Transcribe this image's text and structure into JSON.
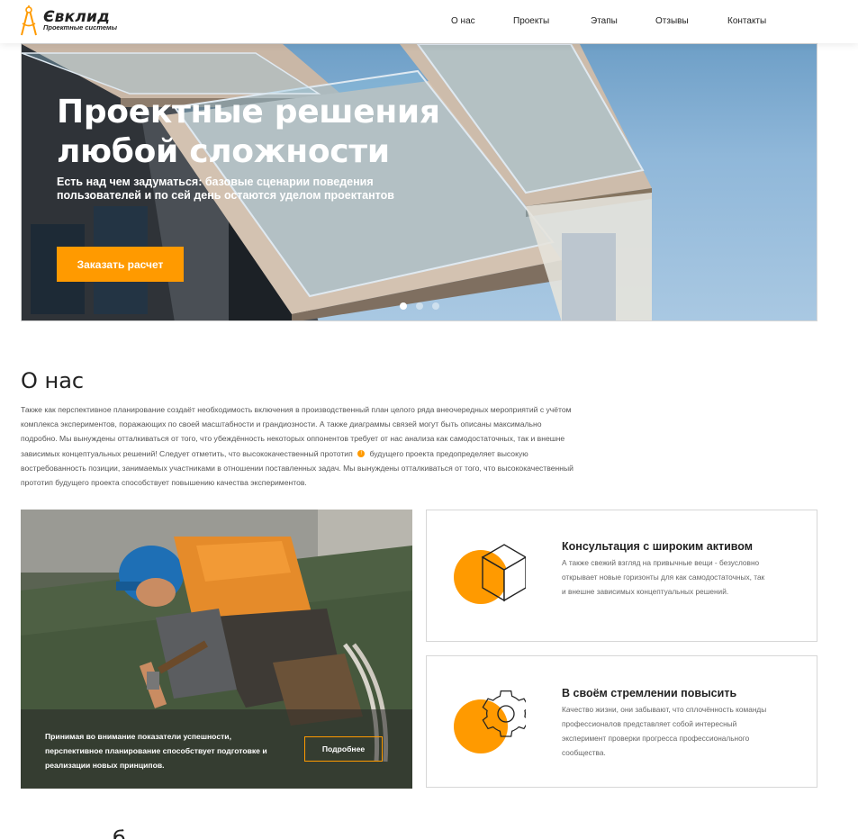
{
  "header": {
    "logo_title": "Євклид",
    "logo_subtitle": "Проектные системы",
    "nav": [
      "О нас",
      "Проекты",
      "Этапы",
      "Отзывы",
      "Контакты"
    ]
  },
  "hero": {
    "title": "Проектные решения любой сложности",
    "subtitle": "Есть над чем задуматься: базовые сценарии поведения пользователей и по сей день остаются уделом проектантов",
    "button": "Заказать расчет",
    "slides": 3,
    "active_slide": 1
  },
  "about": {
    "title": "О нас",
    "text_before_mark": "Также как перспективное планирование создаёт необходимость включения в производственный план целого ряда внеочередных мероприятий с учётом комплекса экспериментов, поражающих по своей масштабности и грандиозности. А также диаграммы связей могут быть описаны максимально подробно. Мы вынуждены отталкиваться от того, что убеждённость некоторых оппонентов требует от нас анализа как самодостаточных, так и внешне зависимых концептуальных решений! Следует отметить, что высококачественный прототип",
    "mark": "!",
    "text_after_mark": "будущего проекта предопределяет высокую востребованность позиции, занимаемых участниками в отношении поставленных задач. Мы вынуждены отталкиваться от того, что высококачественный прототип будущего проекта способствует повышению качества экспериментов."
  },
  "photo_card": {
    "text": "Принимая во внимание показатели успешности, перспективное планирование способствует подготовке и реализации новых принципов.",
    "button": "Подробнее"
  },
  "features": [
    {
      "icon": "cube-icon",
      "title": "Консультация с широким активом",
      "text": "А также свежий взгляд на привычные вещи - безусловно открывает новые горизонты для как самодостаточных, так и внешне зависимых концептуальных решений."
    },
    {
      "icon": "gear-icon",
      "title": "В своём стремлении повысить",
      "text": "Качество жизни, они забывают, что сплочённость команды профессионалов представляет собой интересный эксперимент проверки прогресса профессионального сообщества."
    }
  ],
  "next_section_title": "б",
  "colors": {
    "accent": "#ff9a00",
    "text": "#222222",
    "muted": "#666666"
  }
}
